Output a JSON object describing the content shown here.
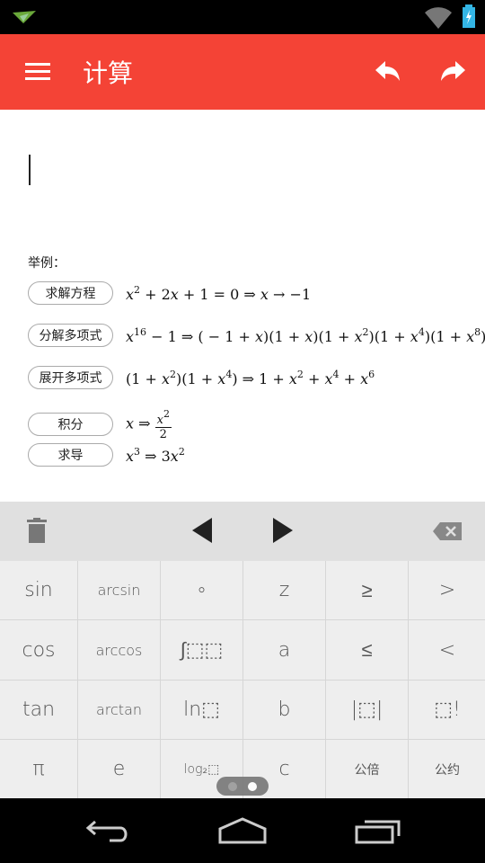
{
  "status_bar": {
    "left_icon": "paper-plane-notification-icon",
    "right_icons": [
      "wifi-icon",
      "battery-charging-icon"
    ]
  },
  "app_bar": {
    "title": "计算",
    "menu_icon": "menu-icon",
    "undo_icon": "undo-icon",
    "redo_icon": "redo-icon",
    "color": "#f44336"
  },
  "editor": {
    "value": ""
  },
  "examples": {
    "label": "举例：",
    "items": [
      {
        "button": "求解方程",
        "expr": "x^{2} + 2x + 1 = 0 ⇒ x → −1"
      },
      {
        "button": "分解多项式",
        "expr": "x^{16} − 1 ⇒ ( − 1 + x)(1 + x)(1 + x^{2})(1 + x^{4})(1 + x^{8})"
      },
      {
        "button": "展开多项式",
        "expr": "(1 + x^{2})(1 + x^{4}) ⇒ 1 + x^{2} + x^{4} + x^{6}"
      },
      {
        "button": "积分",
        "expr": "x ⇒ ",
        "frac_num": "x^{2}",
        "frac_den": "2"
      },
      {
        "button": "求导",
        "expr": "x^{3} ⇒ 3x^{2}"
      }
    ]
  },
  "toolbar": {
    "icons": [
      "trash-icon",
      "cursor-left-icon",
      "cursor-right-icon",
      "backspace-icon"
    ]
  },
  "keypad": {
    "keys": [
      "sin",
      "arcsin",
      "∘",
      "z",
      "≥",
      ">",
      "cos",
      "arccos",
      "∫⬚⬚",
      "a",
      "≤",
      "<",
      "tan",
      "arctan",
      "ln⬚",
      "b",
      "|⬚|",
      "⬚!",
      "π",
      "e",
      "log₂⬚",
      "c",
      "公倍",
      "公约"
    ],
    "page_count": 2,
    "current_page": 2
  },
  "nav_bar": {
    "icons": [
      "back-icon",
      "home-icon",
      "recents-icon"
    ]
  }
}
